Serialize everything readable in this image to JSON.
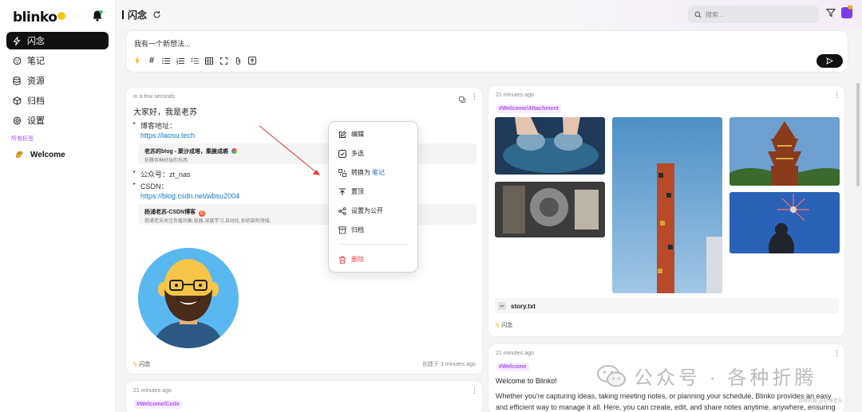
{
  "app": {
    "logo": "blinko"
  },
  "sidebar": {
    "items": [
      {
        "label": "闪念",
        "icon": "bolt-icon",
        "active": true
      },
      {
        "label": "笔记",
        "icon": "note-icon"
      },
      {
        "label": "资源",
        "icon": "database-icon"
      },
      {
        "label": "归档",
        "icon": "archive-icon"
      },
      {
        "label": "设置",
        "icon": "gear-icon"
      }
    ],
    "tags_label": "所有标签",
    "tag": "Welcome"
  },
  "header": {
    "title": "闪念",
    "search_placeholder": "搜索...",
    "notif_count": "7"
  },
  "composer": {
    "placeholder": "我有一个新想法..."
  },
  "card1": {
    "time": "in a few seconds",
    "greeting": "大家好，我是老苏",
    "blog_label": "博客地址：",
    "blog_link": "https://laosu.tech",
    "blog_embed_title": "老苏的blog - 聚沙成塔，集腋成裘",
    "blog_embed_desc": "折腾各种好玩的东西",
    "wechat_label": "公众号：zt_nas",
    "csdn_label": "CSDN：",
    "csdn_link": "https://blog.csdn.net/wbsu2004",
    "csdn_embed_title": "杨浦老苏-CSDN博客",
    "csdn_embed_desc": "杨浦老苏关注负载均衡,容器,深度学习,自动化,系统架构领域.",
    "tag": "闪念",
    "created": "创建于 3 minutes ago"
  },
  "card2": {
    "time": "21 minutes ago",
    "hashtag": "#Welcome/Attachment",
    "file_name": "story.txt",
    "file_icon_label": "txt",
    "tag": "闪念"
  },
  "card3": {
    "time": "21 minutes ago",
    "hashtag": "#Welcome",
    "title": "Welcome to Blinko!",
    "body": "Whether you're capturing ideas, taking meeting notes, or planning your schedule, Blinko provides an easy and efficient way to manage it all. Here, you can create, edit, and share notes anytime, anywhere, ensuring"
  },
  "card4": {
    "time": "21 minutes ago",
    "hashtag": "#Welcome/Code"
  },
  "context_menu": {
    "edit": "编辑",
    "multi_select": "多选",
    "convert_prefix": "转换为",
    "convert_target": "笔记",
    "pin": "置顶",
    "make_public": "设置为公开",
    "archive": "归档",
    "delete": "删除"
  },
  "watermark": {
    "text": "公众号 · 各种折腾",
    "small": "各种折腾 @杨浦老苏"
  },
  "colors": {
    "accent": "#a855f7",
    "link": "#1677c7",
    "danger": "#ef4444",
    "bolt": "#f59e0b"
  }
}
